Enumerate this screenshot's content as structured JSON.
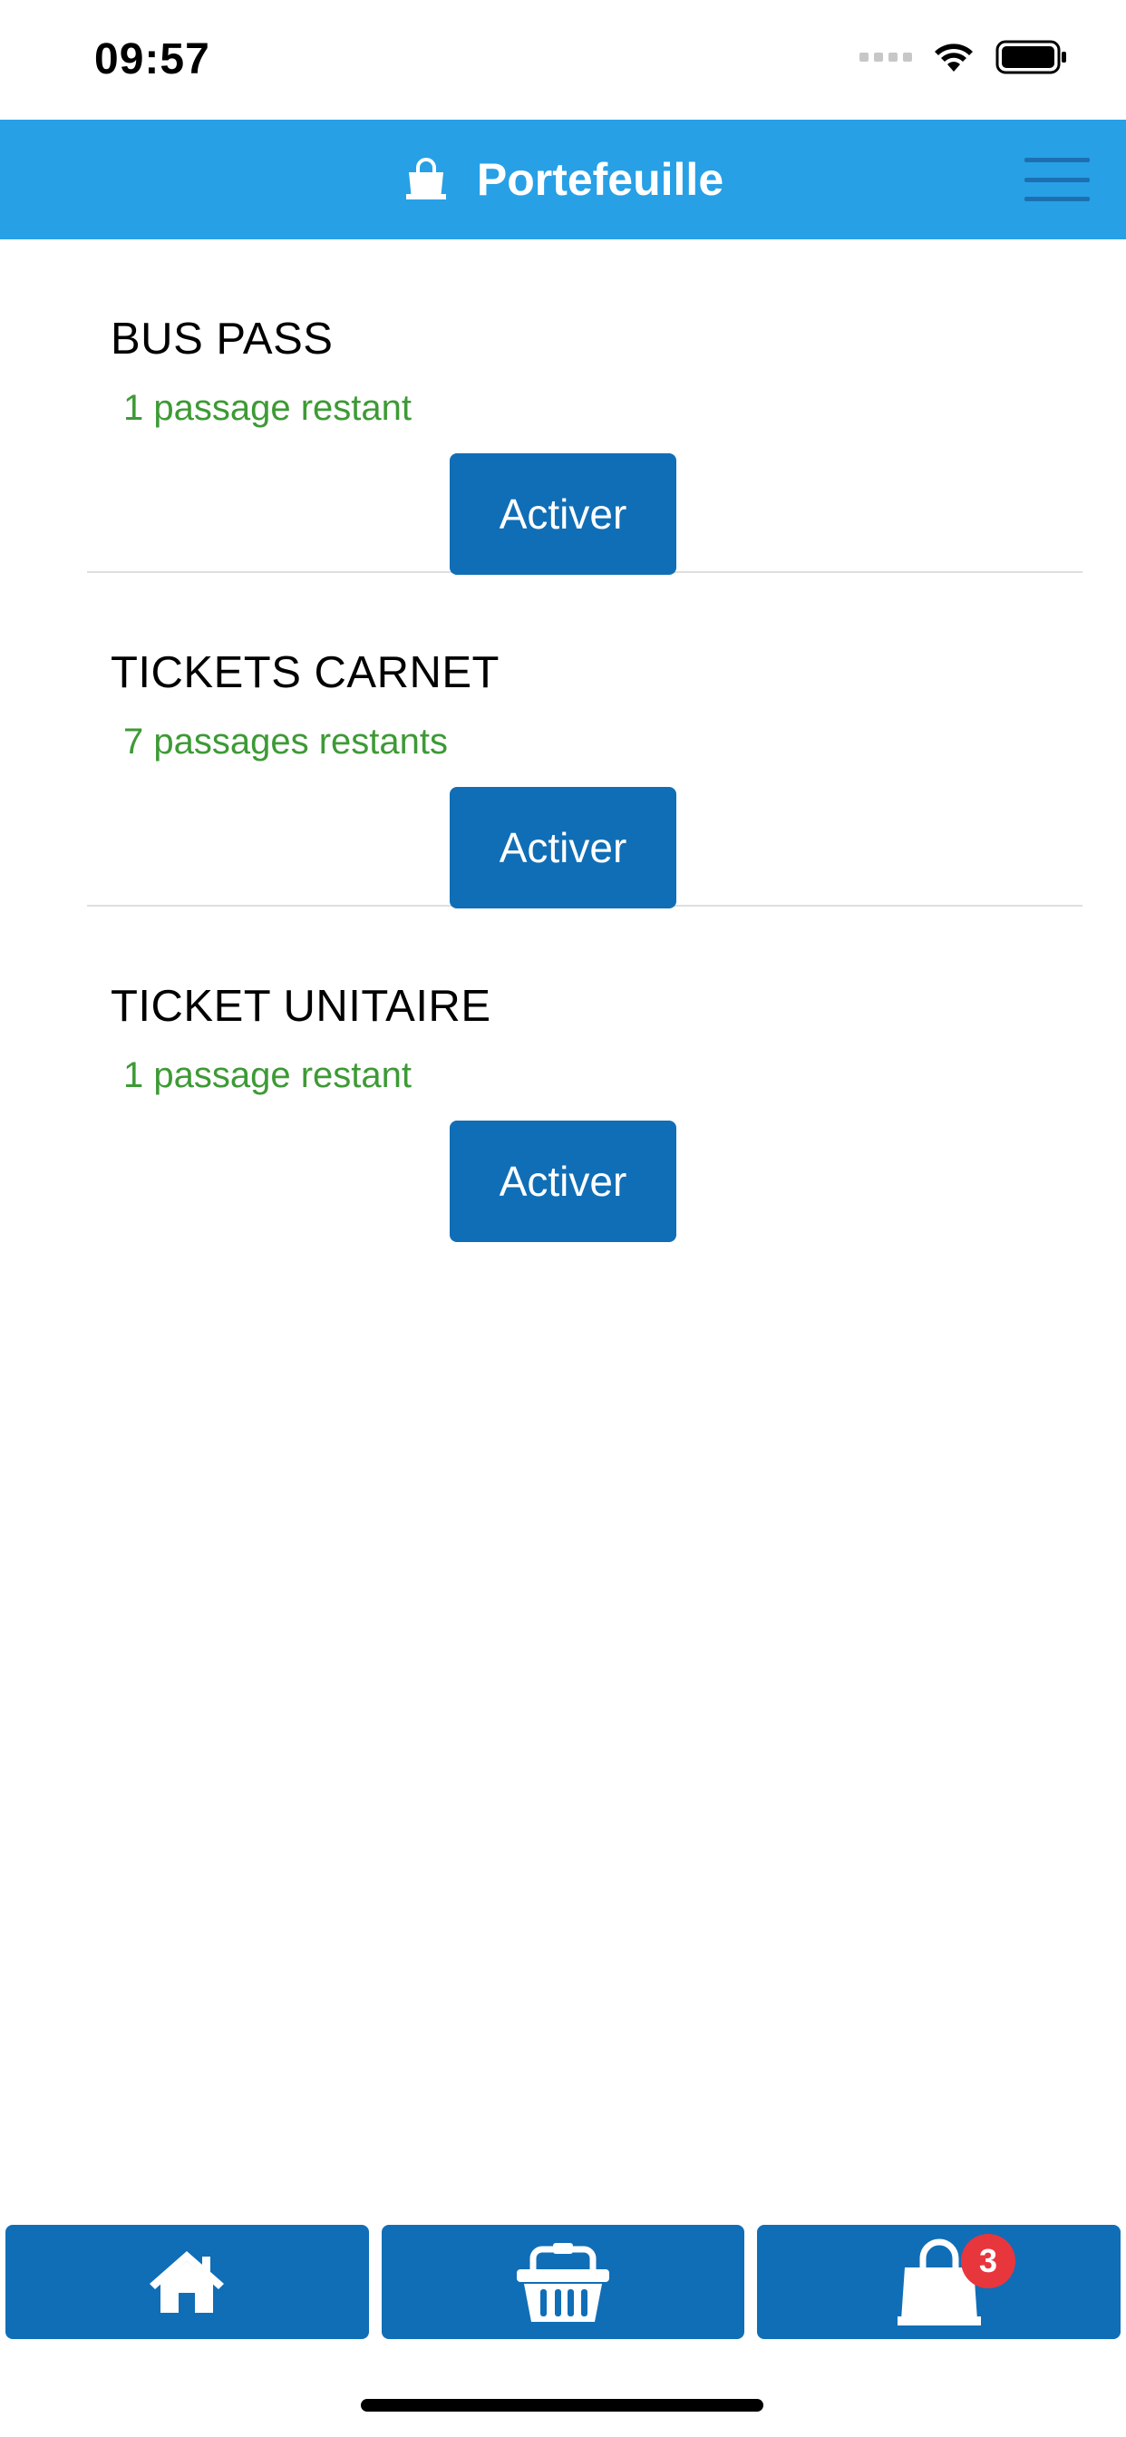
{
  "status_bar": {
    "time": "09:57"
  },
  "header": {
    "title": "Portefeuille",
    "icon": "shopping-bag-icon",
    "menu_icon": "hamburger-menu-icon",
    "background": "#27a0e6"
  },
  "items": [
    {
      "name": "BUS PASS",
      "remaining": "1 passage restant",
      "button": "Activer"
    },
    {
      "name": "TICKETS CARNET",
      "remaining": "7 passages restants",
      "button": "Activer"
    },
    {
      "name": "TICKET UNITAIRE",
      "remaining": "1 passage restant",
      "button": "Activer"
    }
  ],
  "tabbar": {
    "tabs": [
      {
        "icon": "home-icon"
      },
      {
        "icon": "basket-icon"
      },
      {
        "icon": "shopping-bag-icon",
        "badge": "3"
      }
    ]
  },
  "colors": {
    "accent": "#106eb6",
    "success": "#3d9a35",
    "badge": "#e8363d"
  }
}
